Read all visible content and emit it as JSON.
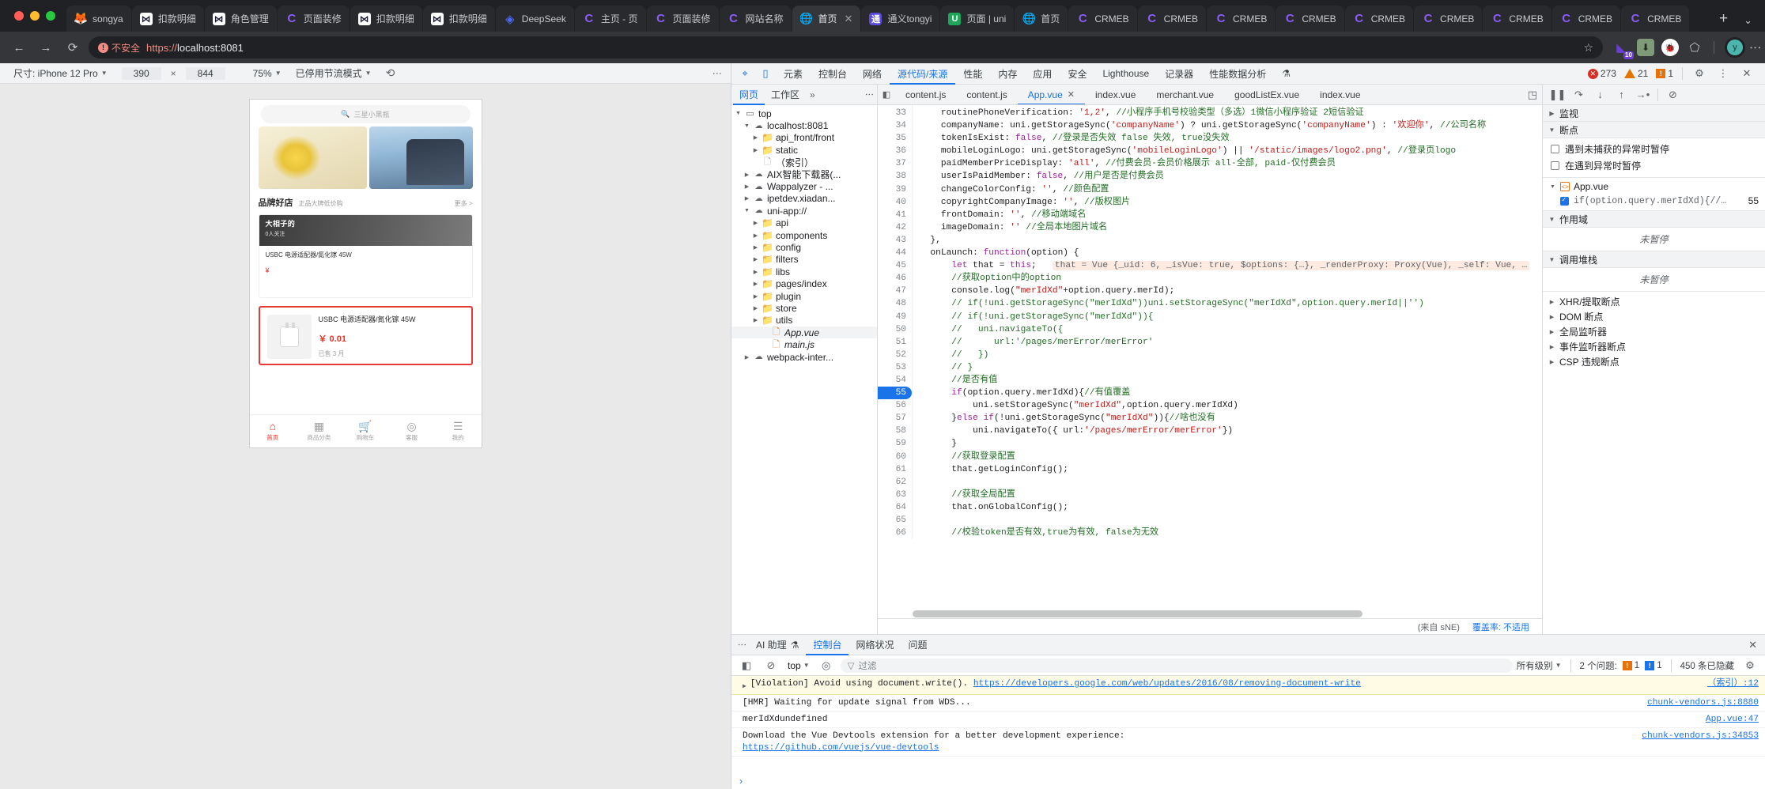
{
  "browser": {
    "tabs": [
      {
        "title": "songya",
        "icon": "gitlab-icon",
        "fav": "fav-fire",
        "glyph": "🦊",
        "active": false
      },
      {
        "title": "扣款明细",
        "icon": "x-icon",
        "fav": "fav-x",
        "glyph": "⋈",
        "active": false
      },
      {
        "title": "角色管理",
        "icon": "x-icon",
        "fav": "fav-x",
        "glyph": "⋈",
        "active": false
      },
      {
        "title": "页面装修",
        "icon": "crmeb-icon",
        "fav": "fav-c",
        "glyph": "C",
        "active": false
      },
      {
        "title": "扣款明细",
        "icon": "x-icon",
        "fav": "fav-x",
        "glyph": "⋈",
        "active": false
      },
      {
        "title": "扣款明细",
        "icon": "x-icon",
        "fav": "fav-x",
        "glyph": "⋈",
        "active": false
      },
      {
        "title": "DeepSeek",
        "icon": "deepseek-icon",
        "fav": "fav-deep",
        "glyph": "◈",
        "active": false
      },
      {
        "title": "主页 - 页",
        "icon": "crmeb-icon",
        "fav": "fav-c",
        "glyph": "C",
        "active": false
      },
      {
        "title": "页面装修",
        "icon": "crmeb-icon",
        "fav": "fav-c",
        "glyph": "C",
        "active": false
      },
      {
        "title": "网站名称",
        "icon": "crmeb-icon",
        "fav": "fav-c",
        "glyph": "C",
        "active": false
      },
      {
        "title": "首页",
        "icon": "globe-icon",
        "fav": "fav-globe",
        "glyph": "🌐",
        "active": true
      },
      {
        "title": "通义tongyi",
        "icon": "tongyi-icon",
        "fav": "fav-tongyi",
        "glyph": "通",
        "active": false
      },
      {
        "title": "页面 | uni",
        "icon": "uni-icon",
        "fav": "fav-u",
        "glyph": "U",
        "active": false
      },
      {
        "title": "首页",
        "icon": "globe-icon",
        "fav": "fav-globe",
        "glyph": "🌐",
        "active": false
      },
      {
        "title": "CRMEB",
        "icon": "crmeb-icon",
        "fav": "fav-c",
        "glyph": "C",
        "active": false
      },
      {
        "title": "CRMEB",
        "icon": "crmeb-icon",
        "fav": "fav-c",
        "glyph": "C",
        "active": false
      },
      {
        "title": "CRMEB",
        "icon": "crmeb-icon",
        "fav": "fav-c",
        "glyph": "C",
        "active": false
      },
      {
        "title": "CRMEB",
        "icon": "crmeb-icon",
        "fav": "fav-c",
        "glyph": "C",
        "active": false
      },
      {
        "title": "CRMEB",
        "icon": "crmeb-icon",
        "fav": "fav-c",
        "glyph": "C",
        "active": false
      },
      {
        "title": "CRMEB",
        "icon": "crmeb-icon",
        "fav": "fav-c",
        "glyph": "C",
        "active": false
      },
      {
        "title": "CRMEB",
        "icon": "crmeb-icon",
        "fav": "fav-c",
        "glyph": "C",
        "active": false
      },
      {
        "title": "CRMEB",
        "icon": "crmeb-icon",
        "fav": "fav-c",
        "glyph": "C",
        "active": false
      },
      {
        "title": "CRMEB",
        "icon": "crmeb-icon",
        "fav": "fav-c",
        "glyph": "C",
        "active": false
      }
    ],
    "new_tab_label": "+",
    "tab_list_caret": "⌄",
    "omnibox": {
      "security_label": "不安全",
      "security_glyph": "!",
      "url_scheme": "https://",
      "url_host": "localhost:8081",
      "star_glyph": "☆"
    },
    "nav": {
      "back": "←",
      "forward": "→",
      "reload": "⟳"
    },
    "extensions": [
      {
        "name": "collections-icon",
        "glyph": "◤",
        "badge": "10"
      },
      {
        "name": "download-icon",
        "glyph": "⬇",
        "badge": ""
      },
      {
        "name": "crmeb-debug-icon",
        "glyph": "🐞",
        "badge": ""
      },
      {
        "name": "puzzle-icon",
        "glyph": "⬠",
        "badge": ""
      }
    ],
    "avatar_letter": "y",
    "menu_glyph": "⋮"
  },
  "device_toolbar": {
    "size_label": "尺寸: iPhone 12 Pro",
    "width": "390",
    "times": "×",
    "height": "844",
    "zoom": "75%",
    "throttling": "已停用节流模式",
    "rotate_glyph": "⟲",
    "menu_glyph": "⋮"
  },
  "mini_app": {
    "search_placeholder": "三星小黑瓶",
    "search_icon": "search-icon",
    "brand": {
      "title": "品牌好店",
      "subtitle": "正品大牌低价购",
      "more": "更多 >"
    },
    "promo": {
      "title": "大相子的",
      "subtitle": "0人关注",
      "line1": "USBC 电源适配器/氮化镓 45W",
      "price": "¥"
    },
    "product": {
      "title": "USBC 电源适配器/氮化镓 45W",
      "price": "￥ 0.01",
      "sold": "已售 3 月"
    },
    "tabbar": [
      {
        "label": "首页",
        "glyph": "⌂",
        "active": true
      },
      {
        "label": "商品分类",
        "glyph": "▦",
        "active": false
      },
      {
        "label": "购物车",
        "glyph": "🛒",
        "active": false
      },
      {
        "label": "客服",
        "glyph": "◎",
        "active": false
      },
      {
        "label": "我的",
        "glyph": "☰",
        "active": false
      }
    ]
  },
  "devtools": {
    "inspect_icon": "inspect-icon",
    "device_icon": "device-toggle-icon",
    "panels": [
      {
        "label": "元素",
        "active": false
      },
      {
        "label": "控制台",
        "active": false
      },
      {
        "label": "网络",
        "active": false
      },
      {
        "label": "源代码/来源",
        "active": true
      },
      {
        "label": "性能",
        "active": false
      },
      {
        "label": "内存",
        "active": false
      },
      {
        "label": "应用",
        "active": false
      },
      {
        "label": "安全",
        "active": false
      },
      {
        "label": "Lighthouse",
        "active": false
      },
      {
        "label": "记录器",
        "active": false
      },
      {
        "label": "性能数据分析",
        "active": false
      }
    ],
    "counts": {
      "errors": "273",
      "warnings": "21",
      "infos": "1"
    },
    "settings_glyph": "⚙",
    "kebab_glyph": "⋮",
    "close_glyph": "✕",
    "navigator": {
      "tabs": [
        {
          "label": "网页",
          "active": true
        },
        {
          "label": "工作区",
          "active": false
        }
      ],
      "more_glyph": "»",
      "kebab_glyph": "⋮",
      "tree": [
        {
          "indent": 0,
          "twisty": "▼",
          "icon": "frame-icon",
          "icon_class": "ic-frame",
          "glyph": "▭",
          "label": "top",
          "italic": false,
          "selected": false
        },
        {
          "indent": 1,
          "twisty": "▼",
          "icon": "cloud-icon",
          "icon_class": "ic-cloud",
          "glyph": "☁",
          "label": "localhost:8081",
          "italic": false,
          "selected": false
        },
        {
          "indent": 2,
          "twisty": "▶",
          "icon": "folder-icon",
          "icon_class": "ic-folder-blue",
          "glyph": "📁",
          "label": "api_front/front",
          "italic": false,
          "selected": false
        },
        {
          "indent": 2,
          "twisty": "▶",
          "icon": "folder-icon",
          "icon_class": "ic-folder-blue",
          "glyph": "📁",
          "label": "static",
          "italic": false,
          "selected": false
        },
        {
          "indent": 2,
          "twisty": "",
          "icon": "document-icon",
          "icon_class": "ic-doc",
          "glyph": "🗋",
          "label": "（索引）",
          "italic": false,
          "selected": false
        },
        {
          "indent": 1,
          "twisty": "▶",
          "icon": "cloud-icon",
          "icon_class": "ic-cloud",
          "glyph": "☁",
          "label": "AIX智能下载器(...",
          "italic": false,
          "selected": false
        },
        {
          "indent": 1,
          "twisty": "▶",
          "icon": "cloud-icon",
          "icon_class": "ic-cloud",
          "glyph": "☁",
          "label": "Wappalyzer - ...",
          "italic": false,
          "selected": false
        },
        {
          "indent": 1,
          "twisty": "▶",
          "icon": "cloud-icon",
          "icon_class": "ic-cloud",
          "glyph": "☁",
          "label": "ipetdev.xiadan...",
          "italic": false,
          "selected": false
        },
        {
          "indent": 1,
          "twisty": "▼",
          "icon": "cloud-icon",
          "icon_class": "ic-cloud",
          "glyph": "☁",
          "label": "uni-app://",
          "italic": false,
          "selected": false
        },
        {
          "indent": 2,
          "twisty": "▶",
          "icon": "folder-icon",
          "icon_class": "ic-folder-orange",
          "glyph": "📁",
          "label": "api",
          "italic": false,
          "selected": false
        },
        {
          "indent": 2,
          "twisty": "▶",
          "icon": "folder-icon",
          "icon_class": "ic-folder-orange",
          "glyph": "📁",
          "label": "components",
          "italic": false,
          "selected": false
        },
        {
          "indent": 2,
          "twisty": "▶",
          "icon": "folder-icon",
          "icon_class": "ic-folder-orange",
          "glyph": "📁",
          "label": "config",
          "italic": false,
          "selected": false
        },
        {
          "indent": 2,
          "twisty": "▶",
          "icon": "folder-icon",
          "icon_class": "ic-folder-orange",
          "glyph": "📁",
          "label": "filters",
          "italic": false,
          "selected": false
        },
        {
          "indent": 2,
          "twisty": "▶",
          "icon": "folder-icon",
          "icon_class": "ic-folder-orange",
          "glyph": "📁",
          "label": "libs",
          "italic": false,
          "selected": false
        },
        {
          "indent": 2,
          "twisty": "▶",
          "icon": "folder-icon",
          "icon_class": "ic-folder-orange",
          "glyph": "📁",
          "label": "pages/index",
          "italic": false,
          "selected": false
        },
        {
          "indent": 2,
          "twisty": "▶",
          "icon": "folder-icon",
          "icon_class": "ic-folder-orange",
          "glyph": "📁",
          "label": "plugin",
          "italic": false,
          "selected": false
        },
        {
          "indent": 2,
          "twisty": "▶",
          "icon": "folder-icon",
          "icon_class": "ic-folder-orange",
          "glyph": "📁",
          "label": "store",
          "italic": false,
          "selected": false
        },
        {
          "indent": 2,
          "twisty": "▶",
          "icon": "folder-icon",
          "icon_class": "ic-folder-orange",
          "glyph": "📁",
          "label": "utils",
          "italic": false,
          "selected": false
        },
        {
          "indent": 3,
          "twisty": "",
          "icon": "vue-file-icon",
          "icon_class": "ic-doc-orange",
          "glyph": "🗋",
          "label": "App.vue",
          "italic": true,
          "selected": true
        },
        {
          "indent": 3,
          "twisty": "",
          "icon": "js-file-icon",
          "icon_class": "ic-doc-orange",
          "glyph": "🗋",
          "label": "main.js",
          "italic": true,
          "selected": false
        },
        {
          "indent": 1,
          "twisty": "▶",
          "icon": "cloud-icon",
          "icon_class": "ic-cloud",
          "glyph": "☁",
          "label": "webpack-inter...",
          "italic": false,
          "selected": false
        }
      ]
    },
    "editor": {
      "collapse_glyph": "◧",
      "tabs": [
        {
          "label": "content.js",
          "active": false,
          "closable": false
        },
        {
          "label": "content.js",
          "active": false,
          "closable": false
        },
        {
          "label": "App.vue",
          "active": true,
          "closable": true
        },
        {
          "label": "index.vue",
          "active": false,
          "closable": false
        },
        {
          "label": "merchant.vue",
          "active": false,
          "closable": false
        },
        {
          "label": "goodListEx.vue",
          "active": false,
          "closable": false
        },
        {
          "label": "index.vue",
          "active": false,
          "closable": false
        }
      ],
      "close_glyph": "✕",
      "right_glyph": "◳",
      "first_line": 33,
      "breakpoint_line": 55,
      "lines": [
        "    routinePhoneVerification: '1,2', //小程序手机号校验类型（多选）1微信小程序验证 2短信验证",
        "    companyName: uni.getStorageSync('companyName') ? uni.getStorageSync('companyName') : '欢迎你', //公司名称",
        "    tokenIsExist: false, //登录是否失效 false 失效, true没失效",
        "    mobileLoginLogo: uni.getStorageSync('mobileLoginLogo') || '/static/images/logo2.png', //登录页logo",
        "    paidMemberPriceDisplay: 'all', //付费会员-会员价格展示 all-全部, paid-仅付费会员",
        "    userIsPaidMember: false, //用户是否是付费会员",
        "    changeColorConfig: '', //颜色配置",
        "    copyrightCompanyImage: '', //版权图片",
        "    frontDomain: '', //移动端域名",
        "    imageDomain: '' //全局本地图片域名",
        "  },",
        "  onLaunch: function(option) {",
        "      let that = this;   that = Vue {_uid: 6, _isVue: true, $options: {…}, _renderProxy: Proxy(Vue), _self: Vue, …",
        "      //获取option中的option",
        "      console.log(\"merIdXd\"+option.query.merId);",
        "      // if(!uni.getStorageSync(\"merIdXd\"))uni.setStorageSync(\"merIdXd\",option.query.merId||'')",
        "      // if(!uni.getStorageSync(\"merIdXd\")){",
        "      //   uni.navigateTo({",
        "      //      url:'/pages/merError/merError'",
        "      //   })",
        "      // }",
        "      //是否有值",
        "      if(option.query.merIdXd){//有值覆盖",
        "          uni.setStorageSync(\"merIdXd\",option.query.merIdXd)",
        "      }else if(!uni.getStorageSync(\"merIdXd\")){//啥也没有",
        "          uni.navigateTo({ url:'/pages/merError/merError'})",
        "      }",
        "      //获取登录配置",
        "      that.getLoginConfig();",
        "",
        "      //获取全局配置",
        "      that.onGlobalConfig();",
        "",
        "      //校验token是否有效,true为有效, false为无效"
      ],
      "coverage_from": "(来自 sNE)",
      "coverage_label": "覆盖率: 不适用"
    },
    "debugger": {
      "toolbar": [
        {
          "name": "resume-icon",
          "glyph": "❚❚"
        },
        {
          "name": "step-over-icon",
          "glyph": "↷"
        },
        {
          "name": "step-into-icon",
          "glyph": "↓"
        },
        {
          "name": "step-out-icon",
          "glyph": "↑"
        },
        {
          "name": "step-icon",
          "glyph": "→•"
        },
        {
          "name": "deactivate-breakpoints-icon",
          "glyph": "⊘"
        }
      ],
      "watch_label": "监视",
      "breakpoints_label": "断点",
      "pause_uncaught_label": "遇到未捕获的异常时暂停",
      "pause_caught_label": "在遇到异常时暂停",
      "bp_file": "App.vue",
      "bp_item": "if(option.query.merIdXd){//…",
      "bp_item_line": "55",
      "scope_label": "作用域",
      "scope_empty": "未暂停",
      "callstack_label": "调用堆栈",
      "callstack_empty": "未暂停",
      "sections": [
        {
          "label": "XHR/提取断点"
        },
        {
          "label": "DOM 断点"
        },
        {
          "label": "全局监听器"
        },
        {
          "label": "事件监听器断点"
        },
        {
          "label": "CSP 违规断点"
        }
      ]
    },
    "drawer": {
      "kebab_glyph": "⋮",
      "ai_label": "AI 助理",
      "ai_glyph": "⚗",
      "tabs": [
        {
          "label": "控制台",
          "active": true
        },
        {
          "label": "网络状况",
          "active": false
        },
        {
          "label": "问题",
          "active": false
        }
      ],
      "close_glyph": "✕",
      "toolbar": {
        "sidebar_glyph": "◧",
        "clear_glyph": "⊘",
        "context": "top",
        "eye_glyph": "◎",
        "filter_glyph": "▽",
        "filter_placeholder": "过滤",
        "levels": "所有级别",
        "issues_label": "2 个问题:",
        "issue_err": "1",
        "issue_info": "1",
        "hidden_label": "450 条已隐藏",
        "settings_glyph": "⚙"
      },
      "logs": [
        {
          "level": "warn",
          "expandable": true,
          "text": "[Violation] Avoid using document.write(). ",
          "link": "https://developers.google.com/web/updates/2016/08/removing-document-write",
          "source": "（索引）:12"
        },
        {
          "level": "info",
          "expandable": false,
          "text": "[HMR] Waiting for update signal from WDS...",
          "link": "",
          "source": "chunk-vendors.js:8880"
        },
        {
          "level": "info",
          "expandable": false,
          "text": "merIdXdundefined",
          "link": "",
          "source": "App.vue:47"
        },
        {
          "level": "info",
          "expandable": false,
          "text": "Download the Vue Devtools extension for a better development experience:",
          "link": "https://github.com/vuejs/vue-devtools",
          "source": "chunk-vendors.js:34853"
        }
      ],
      "prompt_glyph": "›"
    }
  }
}
